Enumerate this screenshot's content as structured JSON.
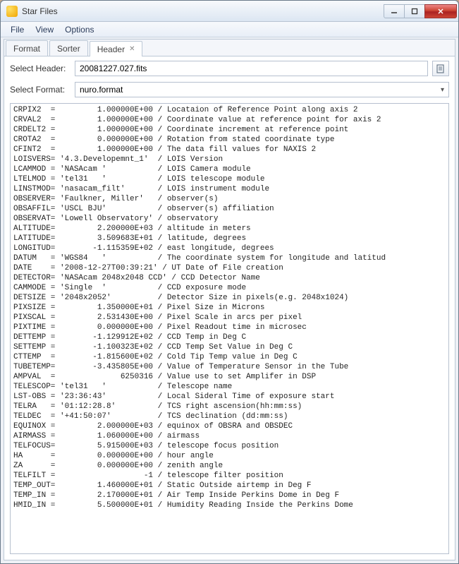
{
  "window": {
    "title": "Star Files"
  },
  "menubar": {
    "items": [
      "File",
      "View",
      "Options"
    ]
  },
  "tabs": {
    "items": [
      {
        "label": "Format",
        "active": false
      },
      {
        "label": "Sorter",
        "active": false
      },
      {
        "label": "Header",
        "active": true,
        "closable": true
      }
    ]
  },
  "form": {
    "header_label": "Select Header:",
    "header_value": "20081227.027.fits",
    "format_label": "Select Format:",
    "format_value": "nuro.format"
  },
  "icons": {
    "open_file": "open-file-icon"
  },
  "header_lines": [
    "CRPIX2  =         1.000000E+00 / Locataion of Reference Point along axis 2",
    "CRVAL2  =         1.000000E+00 / Coordinate value at reference point for axis 2",
    "CRDELT2 =         1.000000E+00 / Coordinate increment at reference point",
    "CROTA2  =         0.000000E+00 / Rotation from stated coordinate type",
    "CFINT2  =         1.000000E+00 / The data fill values for NAXIS 2",
    "LOISVERS= '4.3.Developemnt_1'  / LOIS Version",
    "LCAMMOD = 'NASAcam '           / LOIS Camera module",
    "LTELMOD = 'tel31   '           / LOIS telescope module",
    "LINSTMOD= 'nasacam_filt'       / LOIS instrument module",
    "OBSERVER= 'Faulkner, Miller'   / observer(s)",
    "OBSAFFIL= 'USCL BJU'           / observer(s) affiliation",
    "OBSERVAT= 'Lowell Observatory' / observatory",
    "ALTITUDE=         2.200000E+03 / altitude in meters",
    "LATITUDE=         3.509683E+01 / latitude, degrees",
    "LONGITUD=        -1.115359E+02 / east longitude, degrees",
    "DATUM   = 'WGS84   '           / The coordinate system for longitude and latitud",
    "DATE    = '2008-12-27T00:39:21' / UT Date of File creation",
    "DETECTOR= 'NASAcam 2048x2048 CCD' / CCD Detector Name",
    "CAMMODE = 'Single  '           / CCD exposure mode",
    "DETSIZE = '2048x2052'          / Detector Size in pixels(e.g. 2048x1024)",
    "PIXSIZE =         1.350000E+01 / Pixel Size in Microns",
    "PIXSCAL =         2.531430E+00 / Pixel Scale in arcs per pixel",
    "PIXTIME =         0.000000E+00 / Pixel Readout time in microsec",
    "DETTEMP =        -1.129912E+02 / CCD Temp in Deg C",
    "SETTEMP =        -1.100323E+02 / CCD Temp Set Value in Deg C",
    "CTTEMP  =        -1.815600E+02 / Cold Tip Temp value in Deg C",
    "TUBETEMP=        -3.435805E+00 / Value of Temperature Sensor in the Tube",
    "AMPVAL  =              6250316 / Value use to set Amplifer in DSP",
    "TELESCOP= 'tel31   '           / Telescope name",
    "LST-OBS = '23:36:43'           / Local Sideral Time of exposure start",
    "TELRA   = '01:12:28.8'         / TCS right ascension(hh:mm:ss)",
    "TELDEC  = '+41:50:07'          / TCS declination (dd:mm:ss)",
    "EQUINOX =         2.000000E+03 / equinox of OBSRA and OBSDEC",
    "AIRMASS =         1.060000E+00 / airmass",
    "TELFOCUS=         5.915000E+03 / telescope focus position",
    "HA      =         0.000000E+00 / hour angle",
    "ZA      =         0.000000E+00 / zenith angle",
    "TELFILT =                   -1 / telescope filter position",
    "TEMP_OUT=         1.460000E+01 / Static Outside airtemp in Deg F",
    "TEMP_IN =         2.170000E+01 / Air Temp Inside Perkins Dome in Deg F",
    "HMID_IN =         5.500000E+01 / Humidity Reading Inside the Perkins Dome"
  ]
}
